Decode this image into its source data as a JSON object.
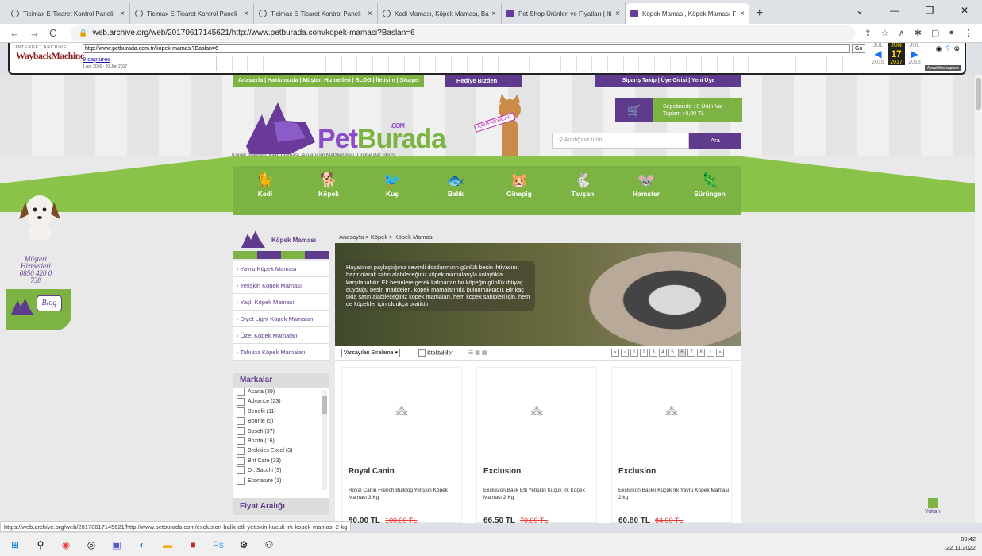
{
  "tabs": [
    {
      "title": "Ticimax E-Ticaret Kontrol Paneli"
    },
    {
      "title": "Ticimax E-Ticaret Kontrol Paneli"
    },
    {
      "title": "Ticimax E-Ticaret Kontrol Paneli"
    },
    {
      "title": "Kedi Maması, Köpek Maması, Ba"
    },
    {
      "title": "Pet Shop Ürünleri ve Fiyatları | Iti"
    },
    {
      "title": "Köpek Maması, Köpek Maması F"
    }
  ],
  "address": {
    "url": "web.archive.org/web/20170617145621/http://www.petburada.com/kopek-mamasi?Baslan=6"
  },
  "wayback": {
    "logo_top": "INTERNET ARCHIVE",
    "logo_main": "WaybackMachine",
    "url_value": "http://www.petburada.com.tr/kopek-mamasi?Baslan=6",
    "go": "Go",
    "captures": "8 captures",
    "range": "1 Apr 2016 - 20 Jun 2017",
    "months": [
      "JUL",
      "JUN",
      "JUL"
    ],
    "day": "17",
    "years": [
      "2016",
      "2017",
      "2018"
    ],
    "about": "About this capture"
  },
  "site": {
    "topnav": "Anasayfa | Hakkımızda | Müşteri Hizmetleri | BLOG | İletişim | Şikayet",
    "hediye": "Hediye Bizden",
    "uyenav": "Sipariş Takip  |  Üye Girişi  |  Yeni Üye",
    "cart_line1": "Sepetinizde : 0 Ürün Var",
    "cart_line2": "Toplam      : 0,00 TL",
    "brand_a": "Pet",
    "brand_b": "Burada",
    "brand_com": ".COM",
    "kampanya": "KAMPANYALAR",
    "tagline": "Köpek maması, Kedi maması, Akvaryum Malzemeleri, Online Pet Shop",
    "search_placeholder": "Aradığınız ürün...",
    "search_btn": "Ara",
    "categories": [
      "Kedi",
      "Köpek",
      "Kuş",
      "Balık",
      "Ginepig",
      "Tavşan",
      "Hamster",
      "Sürüngen"
    ],
    "musteri": "Müşteri Hizmetleri 0850 420 0 738",
    "blog": "Blog",
    "side_title": "Köpek Maması",
    "side_items": [
      "Yavru Köpek Maması",
      "Yetişkin Köpek Maması",
      "Yaşlı Köpek Maması",
      "Diyet Light Köpek Mamaları",
      "Özel Köpek Mamaları",
      "Tahılsız Köpek Mamaları"
    ],
    "markalar_title": "Markalar",
    "markalar": [
      "Acana (39)",
      "Advance (23)",
      "Benefit (11)",
      "Bonnie (5)",
      "Bosch (37)",
      "Bozita (16)",
      "Brekkies Excel (3)",
      "Brit Care (33)",
      "Dr. Sacchi (3)",
      "Econature (1)"
    ],
    "fiyat": "Fiyat Aralığı",
    "breadcrumb": "Anasayfa > Köpek > Köpek Maması",
    "hero_text": "Hayatınızı paylaştığınız sevimli dostlarınızın günlük besin ihtiyacını, hazır olarak satın alabileceğiniz köpek mamalarıyla kolaylıkla karşılanabilir. Ek besinlere gerek kalmadan bir köpeğin günlük ihtiyaç duyduğu besin maddeleri, köpek mamalarında bulunmaktadır. Bir kaç tıkla satın alabileceğiniz köpek mamaları, hem köpek sahipleri için, hem de köpekler için oldukça pratiktir.",
    "sort": "Varsayılan Sıralama",
    "stok": "Stoktakiler",
    "pages": [
      "«",
      "‹",
      "1",
      "2",
      "3",
      "4",
      "5",
      "6",
      "7",
      "8",
      "›",
      "»"
    ],
    "products": [
      {
        "brand": "Royal Canin",
        "name": "Royal Canin French Bulldog Yetişkin Köpek Maması 3 Kg",
        "price": "90,00 TL",
        "old": "100,00 TL"
      },
      {
        "brand": "Exclusion",
        "name": "Exclusion Balık Etli Yetişkin Küçük Irk Köpek Maması 2 Kg",
        "price": "66,50 TL",
        "old": "70,00 TL"
      },
      {
        "brand": "Exclusion",
        "name": "Exclusion Balıklı Küçük Irk Yavru Köpek Maması 2 kg",
        "price": "60,80 TL",
        "old": "64,00 TL"
      }
    ],
    "yukari": "Yukarı"
  },
  "status_url": "https://web.archive.org/web/20170617145621/http://www.petburada.com/exclusion-balik-etli-yetiskin-kucuk-irk-kopek-mamasi-2-kg",
  "clock": {
    "time": "09:42",
    "date": "22.11.2022"
  }
}
